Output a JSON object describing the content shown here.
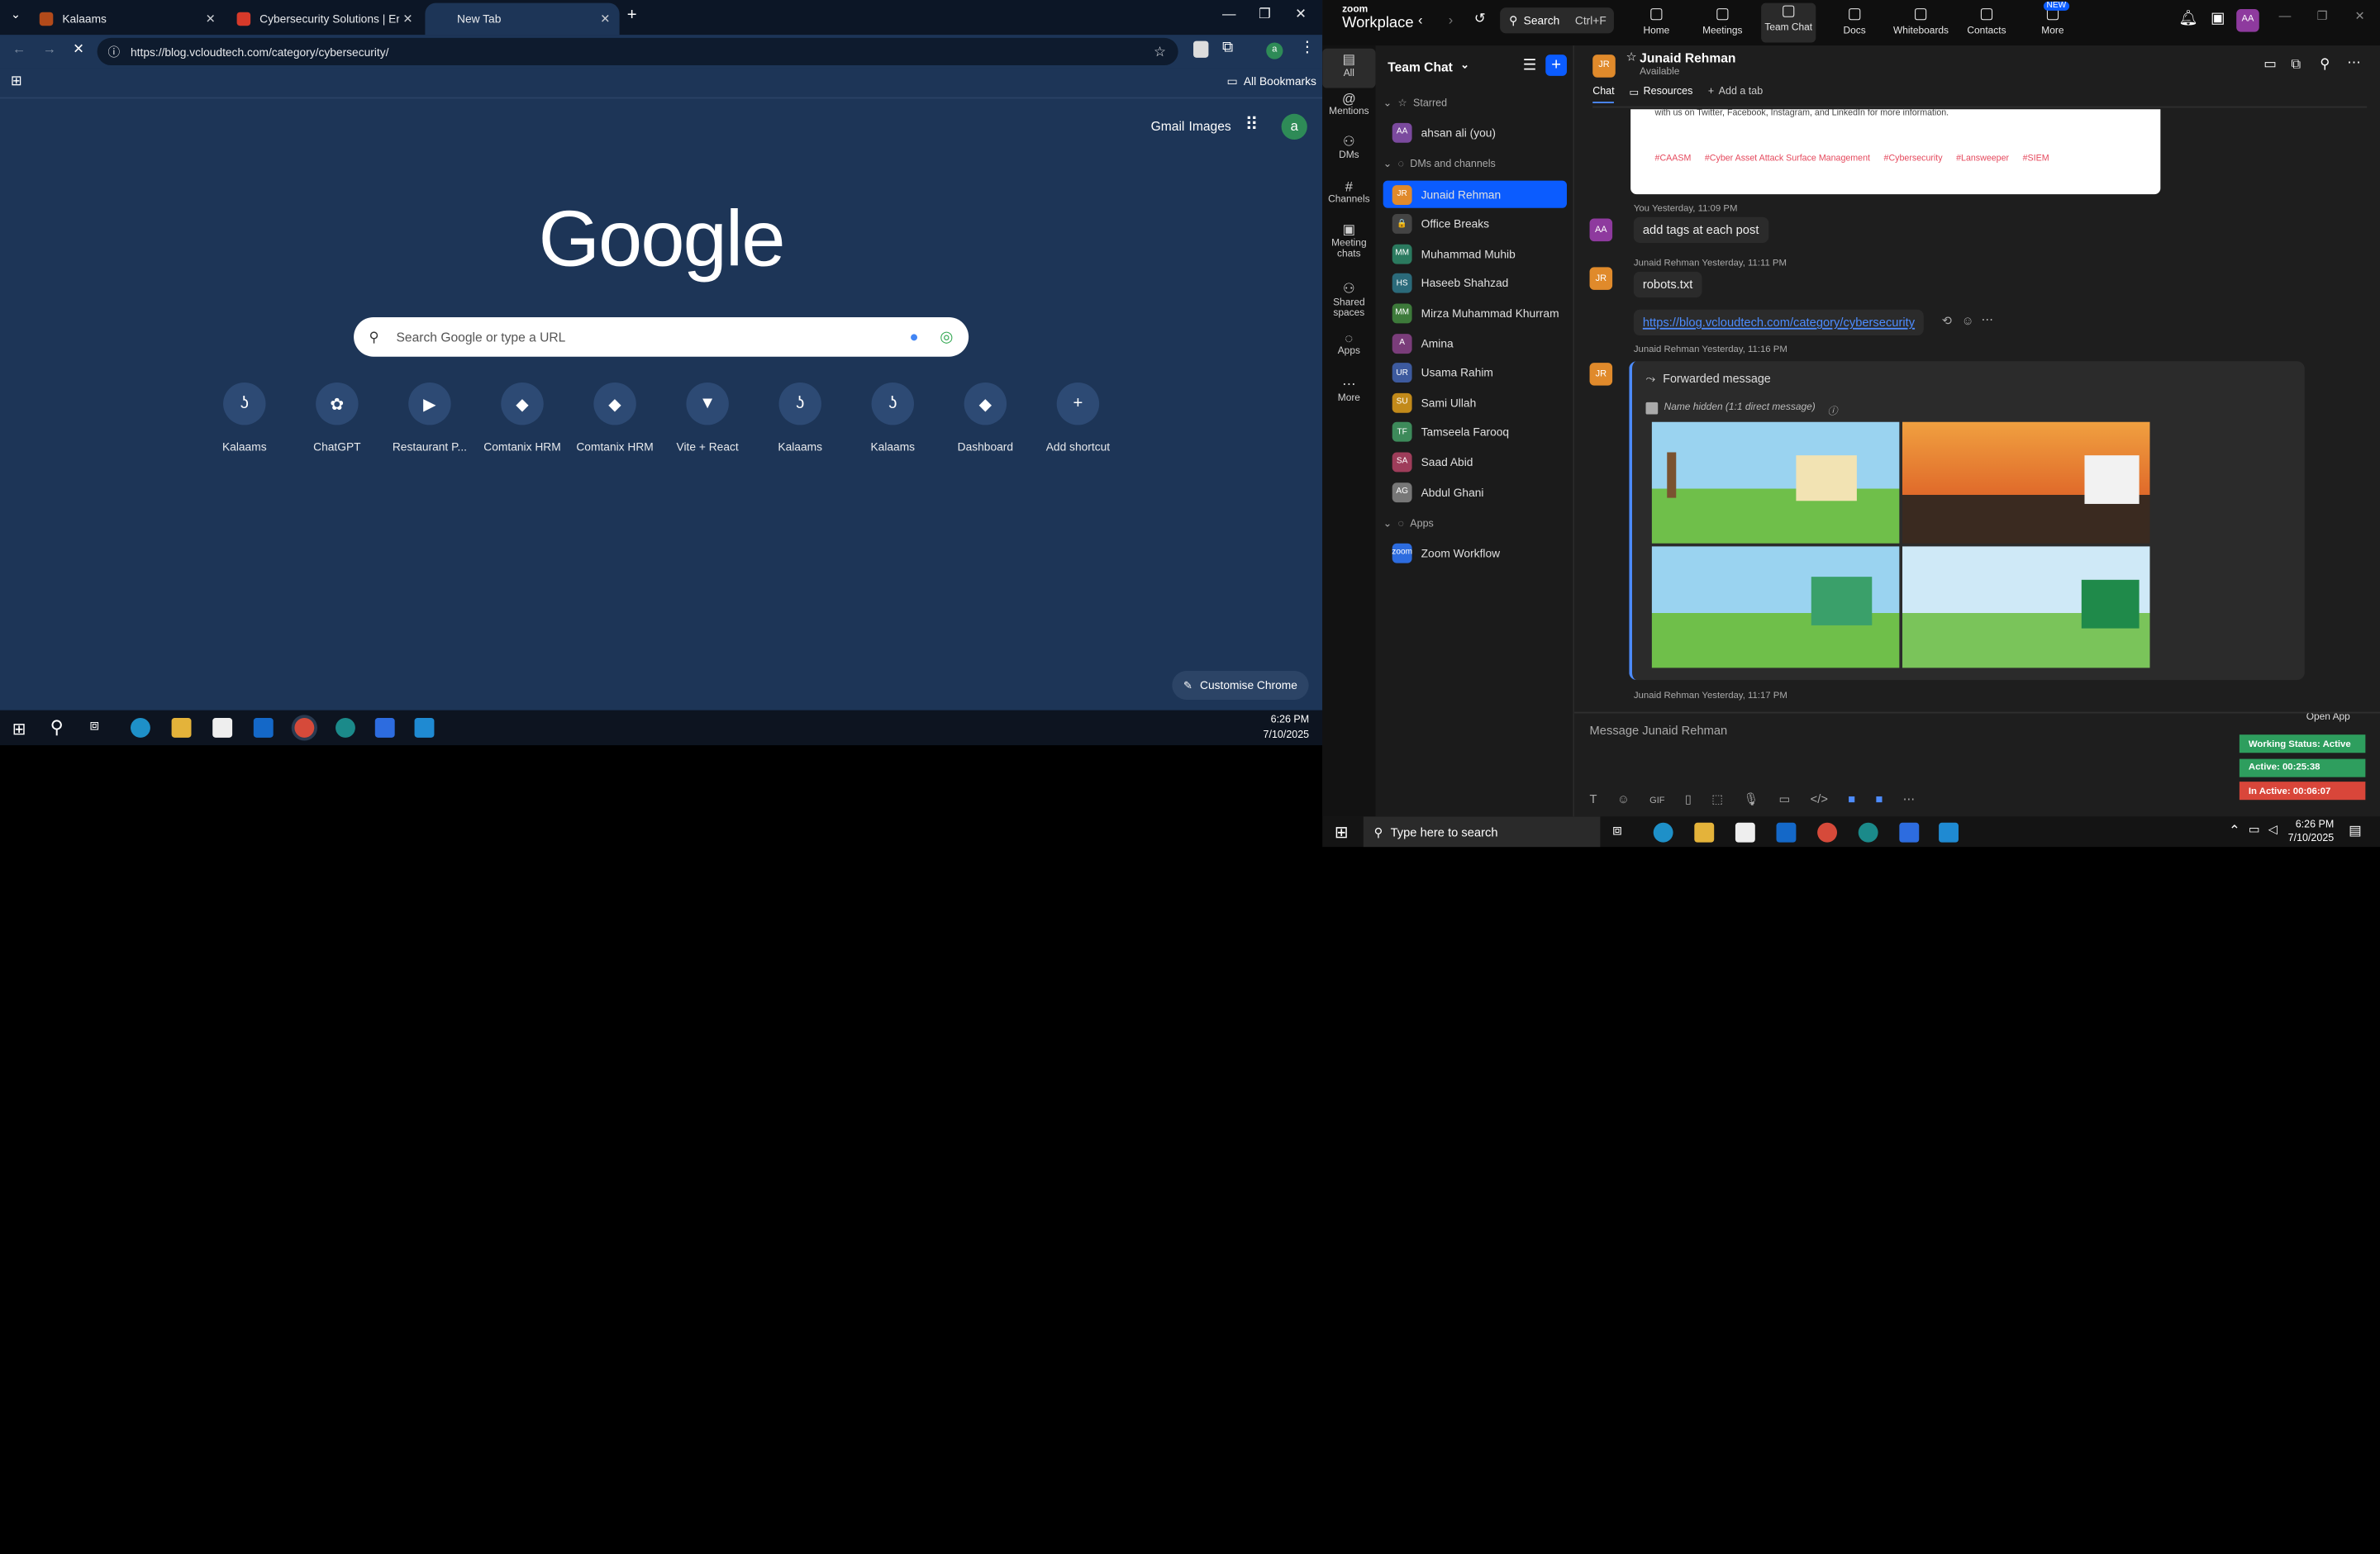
{
  "chrome": {
    "tabs": [
      {
        "title": "Kalaams",
        "icon": "kalaams-favicon"
      },
      {
        "title": "Cybersecurity Solutions | Enterp",
        "icon": "cyber-favicon"
      },
      {
        "title": "New Tab",
        "icon": "chrome-favicon"
      }
    ],
    "url": "https://blog.vcloudtech.com/category/cybersecurity/",
    "all_bookmarks": "All Bookmarks",
    "gmail": "Gmail",
    "images": "Images",
    "profile_initial": "a",
    "logo": "Google",
    "search_placeholder": "Search Google or type a URL",
    "shortcuts": [
      {
        "label": "Kalaams",
        "glyph": "ʖ"
      },
      {
        "label": "ChatGPT",
        "glyph": "✿"
      },
      {
        "label": "Restaurant P...",
        "glyph": "▶"
      },
      {
        "label": "Comtanix HRM",
        "glyph": "◆"
      },
      {
        "label": "Comtanix HRM",
        "glyph": "◆"
      },
      {
        "label": "Vite + React",
        "glyph": "▼"
      },
      {
        "label": "Kalaams",
        "glyph": "ʖ"
      },
      {
        "label": "Kalaams",
        "glyph": "ʖ"
      },
      {
        "label": "Dashboard",
        "glyph": "◆"
      },
      {
        "label": "Add shortcut",
        "glyph": "+"
      }
    ],
    "customise": "Customise Chrome",
    "taskbar_time": "6:26 PM",
    "taskbar_date": "7/10/2025",
    "bg_color": "#1d3557"
  },
  "zoom": {
    "brand_top": "zoom",
    "brand": "Workplace",
    "search": "Search",
    "search_shortcut": "Ctrl+F",
    "nav": [
      {
        "label": "Home",
        "icon": "home-icon"
      },
      {
        "label": "Meetings",
        "icon": "meetings-icon"
      },
      {
        "label": "Team Chat",
        "icon": "team-chat-icon"
      },
      {
        "label": "Docs",
        "icon": "docs-icon"
      },
      {
        "label": "Whiteboards",
        "icon": "whiteboard-icon"
      },
      {
        "label": "Contacts",
        "icon": "contacts-icon"
      },
      {
        "label": "More",
        "icon": "more-icon"
      }
    ],
    "new_badge": "NEW",
    "user_initials": "AA",
    "side": [
      {
        "label": "All",
        "icon": "chat-icon"
      },
      {
        "label": "Mentions",
        "icon": "at-icon"
      },
      {
        "label": "DMs",
        "icon": "dms-icon"
      },
      {
        "label": "Channels",
        "icon": "hash-icon"
      },
      {
        "label": "Meeting chats",
        "icon": "meeting-chat-icon"
      },
      {
        "label": "Shared spaces",
        "icon": "shared-icon"
      },
      {
        "label": "Apps",
        "icon": "apps-icon"
      },
      {
        "label": "More",
        "icon": "more-dots-icon"
      }
    ],
    "list_title": "Team Chat",
    "sections": {
      "starred": "Starred",
      "dms": "DMs and channels",
      "apps": "Apps"
    },
    "starred": [
      {
        "name": "ahsan ali (you)",
        "initials": "AA",
        "color": "#7b4a9e"
      }
    ],
    "contacts": [
      {
        "name": "Junaid Rehman",
        "initials": "JR",
        "color": "#e08a2b"
      },
      {
        "name": "Office Breaks",
        "initials": "🔒",
        "color": "#444"
      },
      {
        "name": "Muhammad Muhib",
        "initials": "MM",
        "color": "#2b7a5f"
      },
      {
        "name": "Haseeb Shahzad",
        "initials": "HS",
        "color": "#2b6a7a"
      },
      {
        "name": "Mirza Muhammad Khurram",
        "initials": "MM",
        "color": "#3d7a3a"
      },
      {
        "name": "Amina",
        "initials": "A",
        "color": "#7a3d7a"
      },
      {
        "name": "Usama Rahim",
        "initials": "UR",
        "color": "#3d5a9e"
      },
      {
        "name": "Sami Ullah",
        "initials": "SU",
        "color": "#c28a1a"
      },
      {
        "name": "Tamseela Farooq",
        "initials": "TF",
        "color": "#3d8a5a"
      },
      {
        "name": "Saad Abid",
        "initials": "SA",
        "color": "#9e3d5a"
      },
      {
        "name": "Abdul Ghani",
        "initials": "AG",
        "color": "#777"
      }
    ],
    "apps": [
      {
        "name": "Zoom Workflow",
        "initials": "zoom",
        "color": "#2d6cdf"
      }
    ],
    "chat_header": {
      "name": "Junaid Rehman",
      "status": "Available",
      "initials": "JR"
    },
    "chat_tabs": {
      "chat": "Chat",
      "resources": "Resources",
      "add_tab": "Add a tab"
    },
    "post_footer_text": "with us on Twitter, Facebook, Instagram, and LinkedIn for more information.",
    "tags": [
      "#CAASM",
      "#Cyber Asset Attack Surface Management",
      "#Cybersecurity",
      "#Lansweeper",
      "#SIEM"
    ],
    "messages": [
      {
        "initials": "AA",
        "sender": "You",
        "time": "Yesterday, 11:09 PM",
        "text": "add tags at each post"
      },
      {
        "initials": "JR",
        "sender": "Junaid Rehman",
        "time": "Yesterday, 11:11 PM",
        "text": "robots.txt"
      },
      {
        "initials": "",
        "sender": "",
        "time": "",
        "text": "https://blog.vcloudtech.com/category/cybersecurity"
      },
      {
        "initials": "JR",
        "sender": "Junaid Rehman",
        "time": "Yesterday, 11:16 PM",
        "text": ""
      },
      {
        "initials": "",
        "sender": "Junaid Rehman",
        "time": "Yesterday, 11:17 PM",
        "text": ""
      }
    ],
    "forwarded": "Forwarded message",
    "name_hidden": "Name hidden (1:1 direct message)",
    "composer_placeholder": "Message Junaid Rehman",
    "open_app": "Open App",
    "work_status": [
      {
        "text": "Working Status: Active",
        "color": "#2e9e5e"
      },
      {
        "text": "Active: 00:25:38",
        "color": "#2e9e5e"
      },
      {
        "text": "In Active: 00:06:07",
        "color": "#d9463a"
      }
    ],
    "taskbar_search": "Type here to search",
    "taskbar_time": "6:26 PM",
    "taskbar_date": "7/10/2025"
  }
}
